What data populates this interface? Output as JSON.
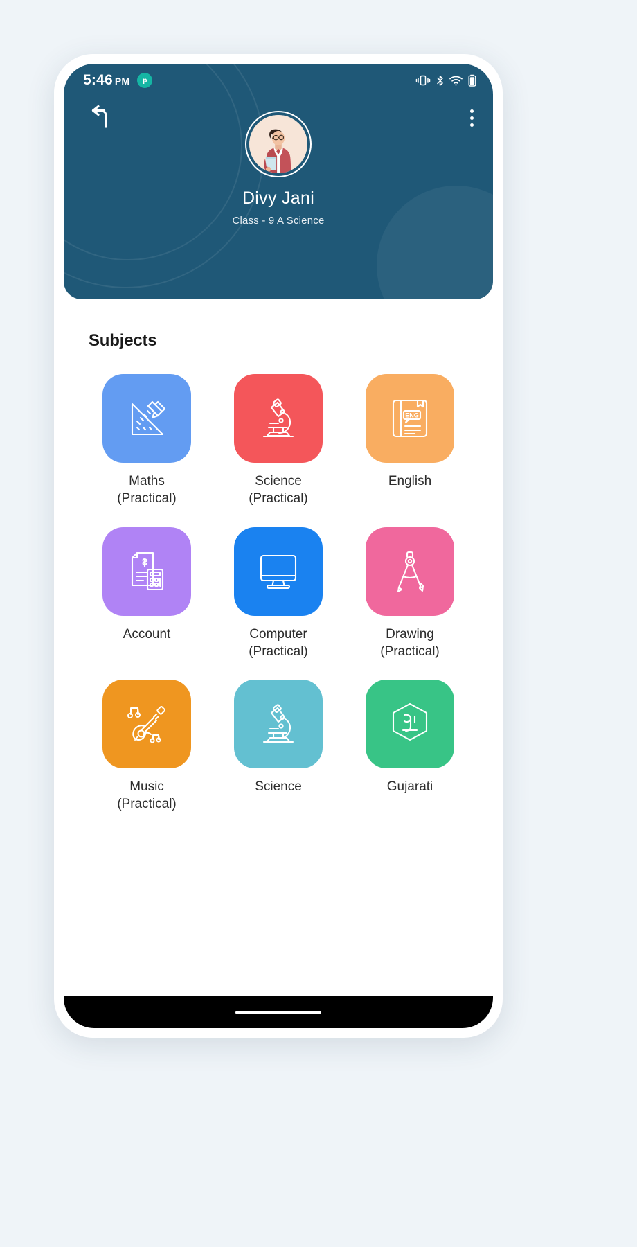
{
  "status_bar": {
    "time": "5:46",
    "ampm": "PM",
    "app_badge": "p",
    "icons": [
      "vibrate-icon",
      "bluetooth-icon",
      "wifi-icon",
      "battery-icon"
    ]
  },
  "header": {
    "back_icon": "back-arrow-icon",
    "menu_icon": "more-vertical-icon",
    "avatar_alt": "student-avatar",
    "user_name": "Divy Jani",
    "user_class": "Class - 9 A Science",
    "background_color": "#1f5877"
  },
  "main": {
    "section_title": "Subjects",
    "subjects": [
      {
        "label": "Maths\n(Practical)",
        "icon": "ruler-pencil-icon",
        "color": "#639cf2"
      },
      {
        "label": "Science\n(Practical)",
        "icon": "microscope-icon",
        "color": "#f4565a"
      },
      {
        "label": "English",
        "icon": "english-book-icon",
        "color": "#f9ad61"
      },
      {
        "label": "Account",
        "icon": "invoice-calculator-icon",
        "color": "#b083f5"
      },
      {
        "label": "Computer\n(Practical)",
        "icon": "monitor-icon",
        "color": "#1a82f0"
      },
      {
        "label": "Drawing\n(Practical)",
        "icon": "compass-divider-icon",
        "color": "#f0689d"
      },
      {
        "label": "Music\n(Practical)",
        "icon": "guitar-music-icon",
        "color": "#ef9620"
      },
      {
        "label": "Science",
        "icon": "microscope-icon",
        "color": "#63c0d1"
      },
      {
        "label": "Gujarati",
        "icon": "gujarati-letter-icon",
        "color": "#38c486"
      }
    ]
  },
  "nav_bar": {
    "pill": "home-indicator"
  }
}
